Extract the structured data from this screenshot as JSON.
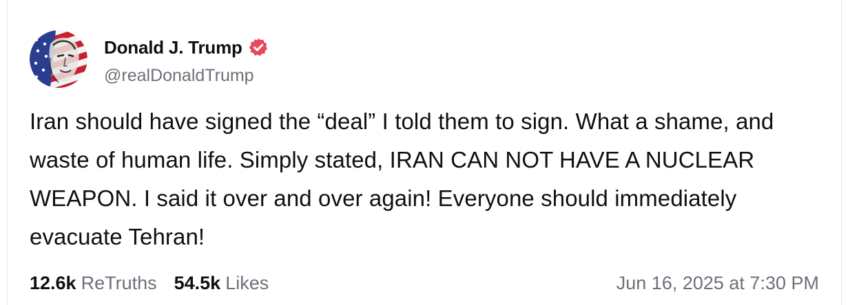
{
  "post": {
    "author": {
      "display_name": "Donald J. Trump",
      "handle": "@realDonaldTrump",
      "verified": true,
      "verified_icon": "verified-badge-icon",
      "verified_color": "#e8485a"
    },
    "text": "Iran should have signed the “deal” I told them to sign. What a shame, and waste of human life. Simply stated, IRAN CAN NOT HAVE A NUCLEAR WEAPON. I said it over and over again! Everyone should immediately evacuate Tehran!",
    "stats": {
      "retruths_count": "12.6k",
      "retruths_label": "ReTruths",
      "likes_count": "54.5k",
      "likes_label": "Likes"
    },
    "timestamp": "Jun 16, 2025 at 7:30 PM"
  }
}
